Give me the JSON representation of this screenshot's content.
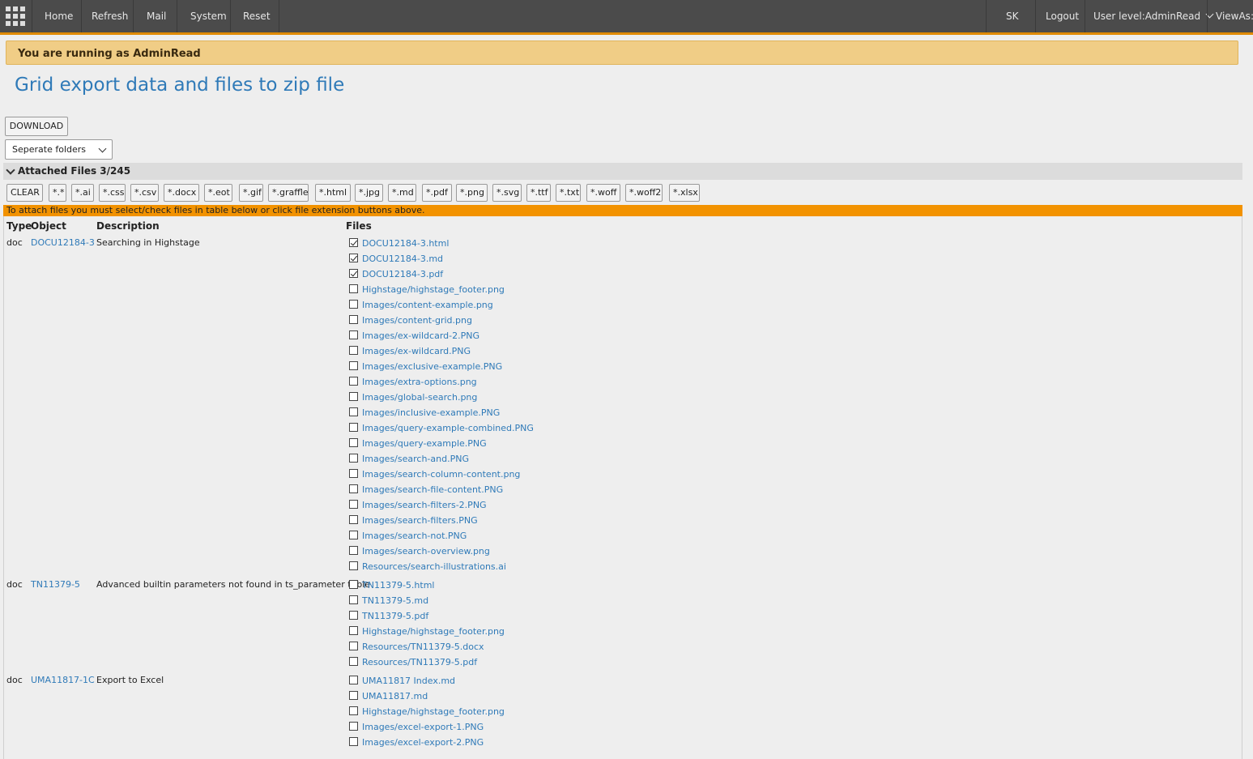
{
  "nav": {
    "items": [
      "Home",
      "Refresh",
      "Mail",
      "System",
      "Reset"
    ],
    "user_initials": "SK",
    "logout": "Logout",
    "user_level": "User level:AdminRead",
    "views_as": "ViewAs:"
  },
  "banner": "You are running as AdminRead",
  "page_title": "Grid export data and files to zip file",
  "download_label": "DOWNLOAD",
  "folder_select": {
    "value": "Seperate folders"
  },
  "section": {
    "label": "Attached Files 3/245"
  },
  "extension_buttons": [
    "CLEAR",
    "*.*",
    "*.ai",
    "*.css",
    "*.csv",
    "*.docx",
    "*.eot",
    "*.gif",
    "*.graffle",
    "*.html",
    "*.jpg",
    "*.md",
    "*.pdf",
    "*.png",
    "*.svg",
    "*.ttf",
    "*.txt",
    "*.woff",
    "*.woff2",
    "*.xlsx"
  ],
  "notice": "To attach files you must select/check files in table below or click file extension buttons above.",
  "table": {
    "headers": {
      "type": "Type",
      "object": "Object",
      "description": "Description",
      "files": "Files"
    },
    "rows": [
      {
        "type": "doc",
        "object": "DOCU12184-3",
        "description": "Searching in Highstage",
        "files": [
          {
            "name": "DOCU12184-3.html",
            "checked": true
          },
          {
            "name": "DOCU12184-3.md",
            "checked": true
          },
          {
            "name": "DOCU12184-3.pdf",
            "checked": true
          },
          {
            "name": "Highstage/highstage_footer.png",
            "checked": false
          },
          {
            "name": "Images/content-example.png",
            "checked": false
          },
          {
            "name": "Images/content-grid.png",
            "checked": false
          },
          {
            "name": "Images/ex-wildcard-2.PNG",
            "checked": false
          },
          {
            "name": "Images/ex-wildcard.PNG",
            "checked": false
          },
          {
            "name": "Images/exclusive-example.PNG",
            "checked": false
          },
          {
            "name": "Images/extra-options.png",
            "checked": false
          },
          {
            "name": "Images/global-search.png",
            "checked": false
          },
          {
            "name": "Images/inclusive-example.PNG",
            "checked": false
          },
          {
            "name": "Images/query-example-combined.PNG",
            "checked": false
          },
          {
            "name": "Images/query-example.PNG",
            "checked": false
          },
          {
            "name": "Images/search-and.PNG",
            "checked": false
          },
          {
            "name": "Images/search-column-content.png",
            "checked": false
          },
          {
            "name": "Images/search-file-content.PNG",
            "checked": false
          },
          {
            "name": "Images/search-filters-2.PNG",
            "checked": false
          },
          {
            "name": "Images/search-filters.PNG",
            "checked": false
          },
          {
            "name": "Images/search-not.PNG",
            "checked": false
          },
          {
            "name": "Images/search-overview.png",
            "checked": false
          },
          {
            "name": "Resources/search-illustrations.ai",
            "checked": false
          }
        ]
      },
      {
        "type": "doc",
        "object": "TN11379-5",
        "description": "Advanced builtin parameters not found in ts_parameter table",
        "files": [
          {
            "name": "TN11379-5.html",
            "checked": false
          },
          {
            "name": "TN11379-5.md",
            "checked": false
          },
          {
            "name": "TN11379-5.pdf",
            "checked": false
          },
          {
            "name": "Highstage/highstage_footer.png",
            "checked": false
          },
          {
            "name": "Resources/TN11379-5.docx",
            "checked": false
          },
          {
            "name": "Resources/TN11379-5.pdf",
            "checked": false
          }
        ]
      },
      {
        "type": "doc",
        "object": "UMA11817-1C",
        "description": "Export to Excel",
        "files": [
          {
            "name": "UMA11817 Index.md",
            "checked": false
          },
          {
            "name": "UMA11817.md",
            "checked": false
          },
          {
            "name": "Highstage/highstage_footer.png",
            "checked": false
          },
          {
            "name": "Images/excel-export-1.PNG",
            "checked": false
          },
          {
            "name": "Images/excel-export-2.PNG",
            "checked": false
          }
        ]
      }
    ]
  }
}
